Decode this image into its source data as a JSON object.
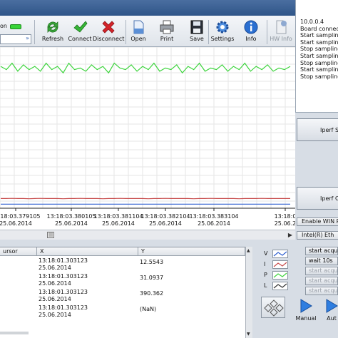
{
  "toolbar": {
    "connection_label": "on",
    "buttons": [
      {
        "label": "Refresh",
        "icon": "refresh-icon"
      },
      {
        "label": "Connect",
        "icon": "checkmark-icon"
      },
      {
        "label": "Disconnect",
        "icon": "x-icon"
      },
      {
        "label": "Open",
        "icon": "document-icon"
      },
      {
        "label": "Print",
        "icon": "printer-icon"
      },
      {
        "label": "Save",
        "icon": "floppy-disk-icon"
      },
      {
        "label": "Settings",
        "icon": "gear-icon"
      },
      {
        "label": "Info",
        "icon": "info-icon"
      },
      {
        "label": "HW Info",
        "icon": "hw-info-icon"
      }
    ]
  },
  "log": {
    "lines": [
      "10.0.0.4",
      "Board connecte",
      "Start sampling.",
      "Start sampling.",
      "Stop sampling.",
      "Start sampling.",
      "Stop sampling.",
      "Start sampling.",
      "Stop sampling."
    ]
  },
  "right_panel": {
    "iperf_server": "Iperf S",
    "iperf_client": "Iperf C",
    "enable_win": "Enable WIN P",
    "intel_eth": "Intel(R) Eth",
    "actions": [
      "start acquisit",
      "wait 10s",
      "start acquisit",
      "start acquisit",
      "start acquisit"
    ]
  },
  "chart_data": {
    "type": "line",
    "x_ticks": [
      {
        "time": "13:18:03.379105",
        "date": "25.06.2014"
      },
      {
        "time": "13:18:03.380105",
        "date": "25.06.2014"
      },
      {
        "time": "13:18:03.381104",
        "date": "25.06.2014"
      },
      {
        "time": "13:18:03.382104",
        "date": "25.06.2014"
      },
      {
        "time": "13:18:03.383104",
        "date": "25.06.2014"
      },
      {
        "time": "13:18:0",
        "date": "25.06.2"
      }
    ],
    "series": [
      {
        "name": "P",
        "color": "#3ed43e",
        "values": [
          0.88,
          0.86,
          0.9,
          0.85,
          0.89,
          0.86,
          0.88,
          0.85,
          0.9,
          0.86,
          0.88,
          0.84,
          0.9,
          0.86,
          0.87,
          0.85,
          0.89,
          0.86,
          0.88,
          0.84,
          0.9,
          0.87,
          0.86,
          0.89,
          0.85,
          0.88,
          0.86,
          0.9,
          0.85,
          0.87,
          0.86,
          0.89,
          0.84,
          0.88,
          0.86,
          0.9,
          0.85,
          0.87,
          0.86,
          0.89,
          0.85,
          0.88,
          0.86,
          0.9,
          0.85,
          0.88,
          0.86,
          0.89,
          0.85,
          0.87,
          0.86,
          0.88
        ]
      },
      {
        "name": "I",
        "color": "#c84c4c",
        "values": [
          0.06,
          0.06,
          0.061,
          0.06,
          0.06,
          0.059,
          0.06,
          0.061,
          0.06,
          0.06,
          0.06,
          0.059,
          0.06,
          0.06,
          0.061,
          0.06,
          0.06,
          0.06,
          0.059,
          0.06,
          0.06,
          0.061,
          0.06,
          0.06,
          0.06,
          0.06,
          0.059,
          0.06,
          0.06,
          0.061,
          0.06,
          0.06,
          0.06,
          0.06,
          0.059,
          0.06,
          0.06,
          0.061,
          0.06,
          0.06,
          0.06,
          0.06,
          0.059,
          0.06,
          0.06,
          0.06,
          0.061,
          0.06,
          0.06,
          0.06,
          0.06,
          0.06
        ]
      },
      {
        "name": "V",
        "color": "#2f5fd0",
        "values": [
          0.025,
          0.025,
          0.025,
          0.025,
          0.025,
          0.025,
          0.025,
          0.025,
          0.025,
          0.025,
          0.025,
          0.025,
          0.025,
          0.025,
          0.025,
          0.025,
          0.025,
          0.025,
          0.025,
          0.025,
          0.025,
          0.025,
          0.025,
          0.025,
          0.025,
          0.025,
          0.025,
          0.025,
          0.025,
          0.025,
          0.025,
          0.025,
          0.025,
          0.025,
          0.025,
          0.025,
          0.025,
          0.025,
          0.025,
          0.025,
          0.025,
          0.025,
          0.025,
          0.025,
          0.025,
          0.025,
          0.025,
          0.025,
          0.025,
          0.025,
          0.025,
          0.025
        ]
      }
    ],
    "grid": true
  },
  "cursor_table": {
    "headers": [
      "ursor",
      "X",
      "Y"
    ],
    "rows": [
      {
        "x_time": "13:18:01.303123",
        "x_date": "25.06.2014",
        "y": "12.5543"
      },
      {
        "x_time": "13:18:01.303123",
        "x_date": "25.06.2014",
        "y": "31.0937"
      },
      {
        "x_time": "13:18:01.303123",
        "x_date": "25.06.2014",
        "y": "390.362"
      },
      {
        "x_time": "13:18:01.303123",
        "x_date": "25.06.2014",
        "y": "(NaN)"
      }
    ]
  },
  "legend": [
    {
      "name": "V",
      "color": "#2f5fd0"
    },
    {
      "name": "I",
      "color": "#c84c4c"
    },
    {
      "name": "P",
      "color": "#3ed43e"
    },
    {
      "name": "L",
      "color": "#333333"
    }
  ],
  "mode_buttons": [
    {
      "label": "Manual",
      "icon": "play-icon"
    },
    {
      "label": "Aut",
      "icon": "play-icon"
    }
  ]
}
